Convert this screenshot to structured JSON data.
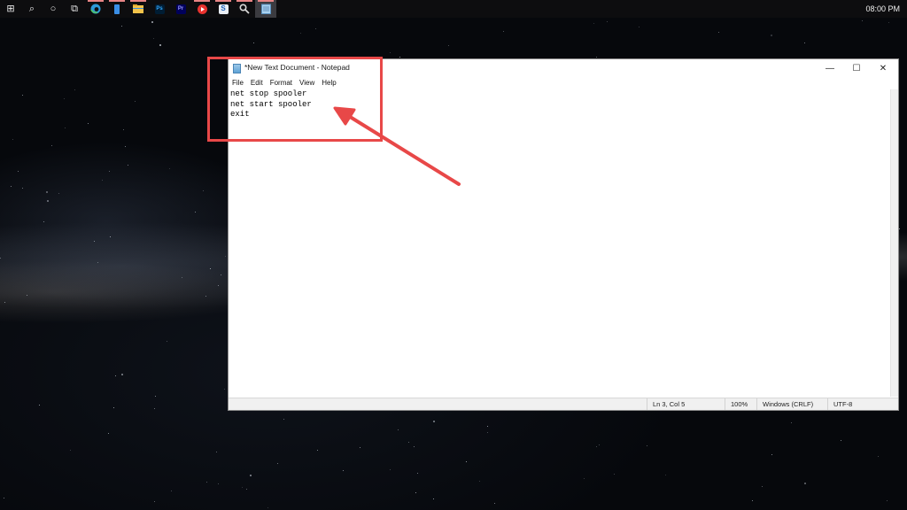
{
  "taskbar": {
    "apps": [
      {
        "name": "start-button",
        "glyph": "⊞"
      },
      {
        "name": "search-icon",
        "glyph": "⌕"
      },
      {
        "name": "cortana-icon",
        "glyph": "○"
      },
      {
        "name": "task-view-icon",
        "glyph": "⧉"
      },
      {
        "name": "edge-icon"
      },
      {
        "name": "phone-icon"
      },
      {
        "name": "file-explorer-icon"
      },
      {
        "name": "photoshop-icon",
        "label": "Ps"
      },
      {
        "name": "premiere-icon",
        "label": "Pr"
      },
      {
        "name": "media-player-icon"
      },
      {
        "name": "sway-icon",
        "label": "S"
      },
      {
        "name": "tools-icon"
      },
      {
        "name": "notepad-taskbar-icon"
      }
    ],
    "clock": "08:00 PM"
  },
  "notepad": {
    "title": "*New Text Document - Notepad",
    "controls": {
      "minimize": "—",
      "maximize": "☐",
      "close": "✕"
    },
    "menu": [
      "File",
      "Edit",
      "Format",
      "View",
      "Help"
    ],
    "content": "net stop spooler\nnet start spooler\nexit",
    "status": {
      "position": "Ln 3, Col 5",
      "zoom": "100%",
      "line_ending": "Windows (CRLF)",
      "encoding": "UTF-8"
    }
  },
  "colors": {
    "annotation": "#e84848",
    "taskbar": "#0d0d0f"
  }
}
